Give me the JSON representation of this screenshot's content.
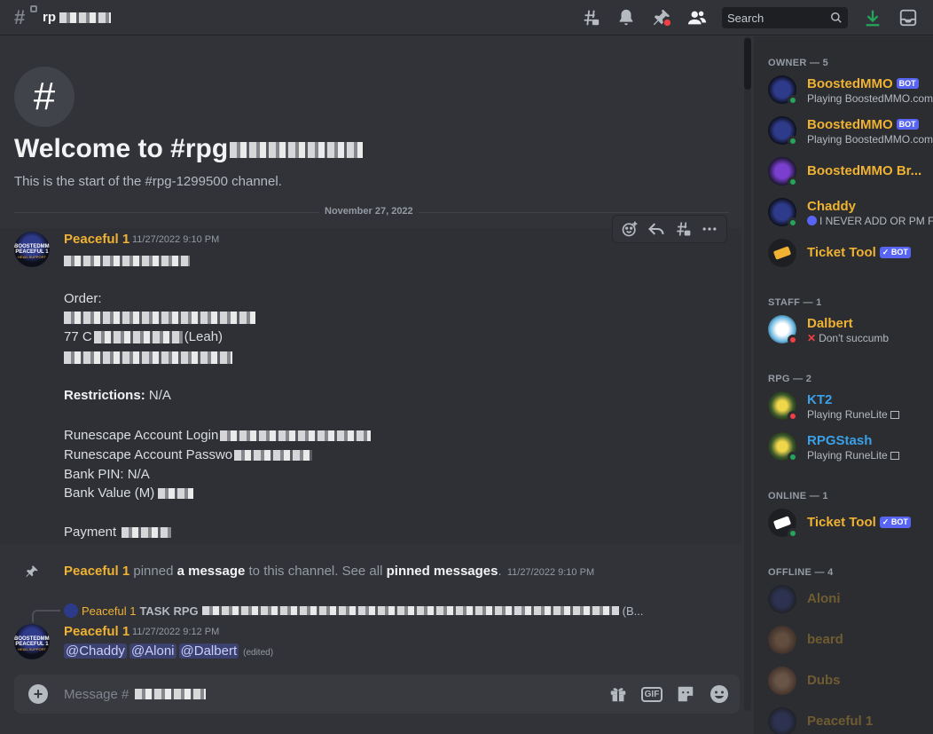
{
  "topbar": {
    "channel_name": "rp",
    "search_placeholder": "Search"
  },
  "welcome": {
    "title": "Welcome to #rpg",
    "subtitle": "This is the start of the #rpg-1299500 channel."
  },
  "divider_date": "November 27, 2022",
  "message1": {
    "author": "Peaceful 1",
    "timestamp": "11/27/2022 9:10 PM",
    "lines": {
      "order": "Order:",
      "order_line2": "77 C",
      "order_line2_end": "(Leah)",
      "restrictions_label": "Restrictions:",
      "restrictions_value": "N/A",
      "login": "Runescape Account Login",
      "password": "Runescape Account Passwo",
      "bank_pin": "Bank PIN: N/A",
      "bank_value": "Bank Value (M)",
      "payment": "Payment"
    }
  },
  "pin_notice": {
    "author": "Peaceful 1",
    "text1": " pinned ",
    "link1": "a message",
    "text2": " to this channel. See all ",
    "link2": "pinned messages",
    "text3": ".",
    "timestamp": "11/27/2022 9:10 PM"
  },
  "reply_preview": {
    "author": "Peaceful 1",
    "text_start": "TASK RPG",
    "text_end": "(B..."
  },
  "message2": {
    "author": "Peaceful 1",
    "timestamp": "11/27/2022 9:12 PM",
    "mentions": [
      "@Chaddy",
      "@Aloni",
      "@Dalbert"
    ],
    "edited": "(edited)"
  },
  "composer": {
    "placeholder": "Message #"
  },
  "members": {
    "groups": [
      {
        "label": "OWNER — 5"
      },
      {
        "label": "STAFF — 1"
      },
      {
        "label": "RPG — 2"
      },
      {
        "label": "ONLINE — 1"
      },
      {
        "label": "OFFLINE — 4"
      }
    ],
    "owner": [
      {
        "name": "BoostedMMO",
        "tag": "BOT",
        "activity": "Playing BoostedMMO.com"
      },
      {
        "name": "BoostedMMO",
        "tag": "BOT",
        "activity": "Playing BoostedMMO.com"
      },
      {
        "name": "BoostedMMO Br..."
      },
      {
        "name": "Chaddy",
        "activity": "I NEVER ADD OR PM F..."
      },
      {
        "name": "Ticket Tool",
        "tag": "✓ BOT"
      }
    ],
    "staff": [
      {
        "name": "Dalbert",
        "activity": "Don't succumb"
      }
    ],
    "rpg": [
      {
        "name": "KT2",
        "activity": "Playing RuneLite"
      },
      {
        "name": "RPGStash",
        "activity": "Playing RuneLite"
      }
    ],
    "online": [
      {
        "name": "Ticket Tool",
        "tag": "✓ BOT"
      }
    ],
    "offline": [
      {
        "name": "Aloni"
      },
      {
        "name": "beard"
      },
      {
        "name": "Dubs"
      },
      {
        "name": "Peaceful 1"
      }
    ]
  },
  "colors": {
    "gold_role": "#f0b232",
    "blue_role": "#3ba0e6",
    "online": "#23a55a",
    "dnd": "#f23f43",
    "blurple": "#5865f2"
  }
}
